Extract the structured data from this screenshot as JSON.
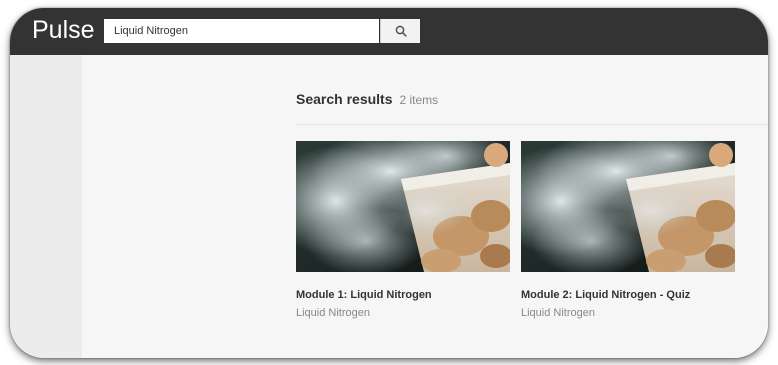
{
  "header": {
    "logo": "Pulse",
    "search": {
      "value": "Liquid Nitrogen",
      "button_icon": "search-icon"
    }
  },
  "results": {
    "title": "Search results",
    "count": "2 items",
    "items": [
      {
        "title": "Module 1: Liquid Nitrogen",
        "subtitle": "Liquid Nitrogen",
        "image_icon": "liquid-nitrogen-cup-image"
      },
      {
        "title": "Module 2: Liquid Nitrogen - Quiz",
        "subtitle": "Liquid Nitrogen",
        "image_icon": "liquid-nitrogen-cup-image"
      }
    ]
  },
  "colors": {
    "topbar": "#333333",
    "background": "#f6f6f6",
    "sidebar": "#ececec",
    "title_text": "#333333",
    "muted_text": "#888888"
  }
}
